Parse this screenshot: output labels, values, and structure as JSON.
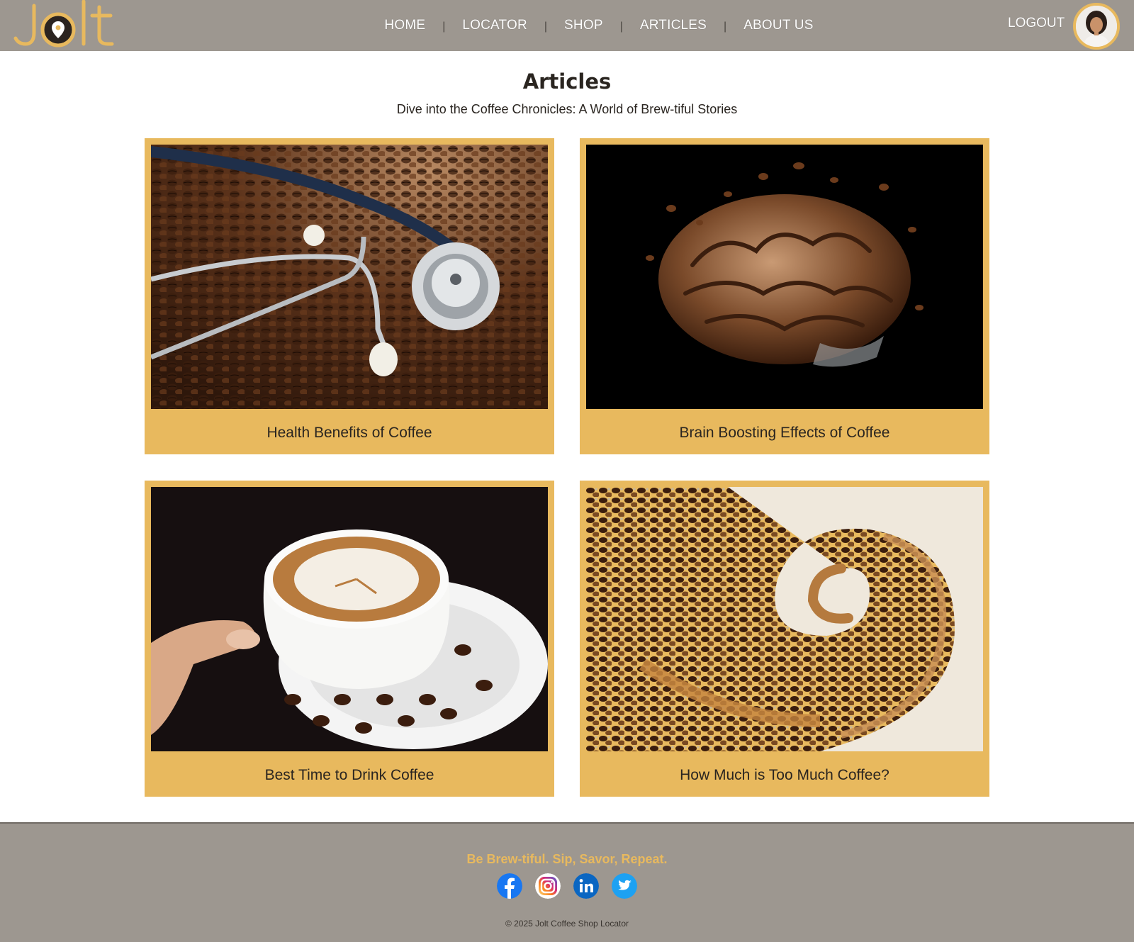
{
  "header": {
    "logo_text": "Jolt",
    "nav": [
      {
        "label": "HOME"
      },
      {
        "label": "LOCATOR"
      },
      {
        "label": "SHOP"
      },
      {
        "label": "ARTICLES"
      },
      {
        "label": "ABOUT US"
      }
    ],
    "separator": "|",
    "logout_label": "LOGOUT"
  },
  "main": {
    "title": "Articles",
    "subtitle": "Dive into the Coffee Chronicles: A World of Brew-tiful Stories",
    "articles": [
      {
        "title": "Health Benefits of Coffee"
      },
      {
        "title": "Brain Boosting Effects of Coffee"
      },
      {
        "title": "Best Time to Drink Coffee"
      },
      {
        "title": "How Much is Too Much Coffee?"
      }
    ]
  },
  "footer": {
    "tagline": "Be Brew-tiful. Sip, Savor, Repeat.",
    "socials": [
      "facebook-icon",
      "instagram-icon",
      "linkedin-icon",
      "twitter-icon"
    ],
    "copyright": "© 2025 Jolt Coffee Shop Locator"
  },
  "colors": {
    "header_bg": "#9d9790",
    "accent": "#e8b95e",
    "footer_bg": "#9d9790"
  }
}
